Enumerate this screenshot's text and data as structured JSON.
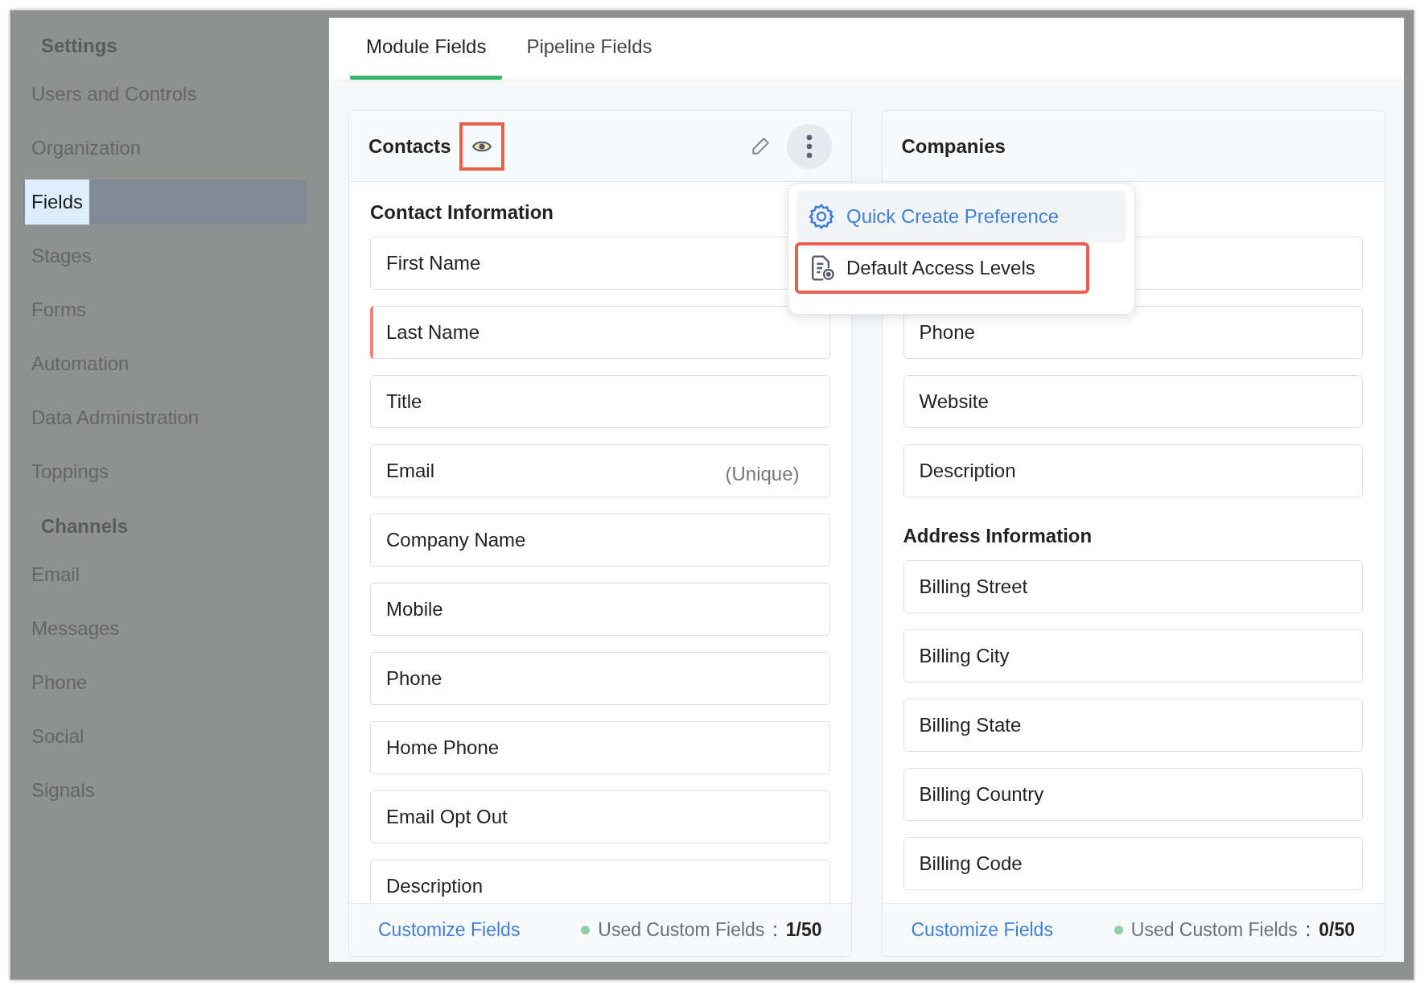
{
  "sidebar": {
    "sections": [
      {
        "heading": "Settings",
        "items": [
          {
            "label": "Users and Controls",
            "selected": false
          },
          {
            "label": "Organization",
            "selected": false
          },
          {
            "label": "Fields",
            "selected": true
          },
          {
            "label": "Stages",
            "selected": false
          },
          {
            "label": "Forms",
            "selected": false
          },
          {
            "label": "Automation",
            "selected": false
          },
          {
            "label": "Data Administration",
            "selected": false
          },
          {
            "label": "Toppings",
            "selected": false
          }
        ]
      },
      {
        "heading": "Channels",
        "items": [
          {
            "label": "Email",
            "selected": false
          },
          {
            "label": "Messages",
            "selected": false
          },
          {
            "label": "Phone",
            "selected": false
          },
          {
            "label": "Social",
            "selected": false
          },
          {
            "label": "Signals",
            "selected": false
          }
        ]
      }
    ]
  },
  "tabs": [
    {
      "label": "Module Fields",
      "selected": true
    },
    {
      "label": "Pipeline Fields",
      "selected": false
    }
  ],
  "modules": [
    {
      "title": "Contacts",
      "eye_highlighted": true,
      "sections": [
        {
          "title": "Contact Information",
          "fields": [
            {
              "label": "First Name",
              "mandatory": false
            },
            {
              "label": "Last Name",
              "mandatory": true
            },
            {
              "label": "Title",
              "mandatory": false
            },
            {
              "label": "Email",
              "mandatory": false,
              "tag": "(Unique)"
            },
            {
              "label": "Company Name",
              "mandatory": false
            },
            {
              "label": "Mobile",
              "mandatory": false
            },
            {
              "label": "Phone",
              "mandatory": false
            },
            {
              "label": "Home Phone",
              "mandatory": false
            },
            {
              "label": "Email Opt Out",
              "mandatory": false
            },
            {
              "label": "Description",
              "mandatory": false
            }
          ]
        }
      ],
      "footer": {
        "link": "Customize Fields",
        "label": "Used Custom Fields",
        "separator": ":",
        "count": "1/50"
      },
      "menu": [
        {
          "kind": "gear",
          "label": "Quick Create Preference",
          "selected": true,
          "highlighted": false
        },
        {
          "kind": "document",
          "label": "Default Access Levels",
          "selected": false,
          "highlighted": true
        }
      ]
    },
    {
      "title": "Companies",
      "sections": [
        {
          "fields": [
            {
              "label": "Phone",
              "mandatory": false
            },
            {
              "label": "Website",
              "mandatory": false
            },
            {
              "label": "Description",
              "mandatory": false
            }
          ]
        },
        {
          "title": "Address Information",
          "fields": [
            {
              "label": "Billing Street",
              "mandatory": false
            },
            {
              "label": "Billing City",
              "mandatory": false
            },
            {
              "label": "Billing State",
              "mandatory": false
            },
            {
              "label": "Billing Country",
              "mandatory": false
            },
            {
              "label": "Billing Code",
              "mandatory": false
            }
          ]
        }
      ],
      "footer": {
        "link": "Customize Fields",
        "label": "Used Custom Fields",
        "separator": ":",
        "count": "0/50"
      }
    }
  ]
}
